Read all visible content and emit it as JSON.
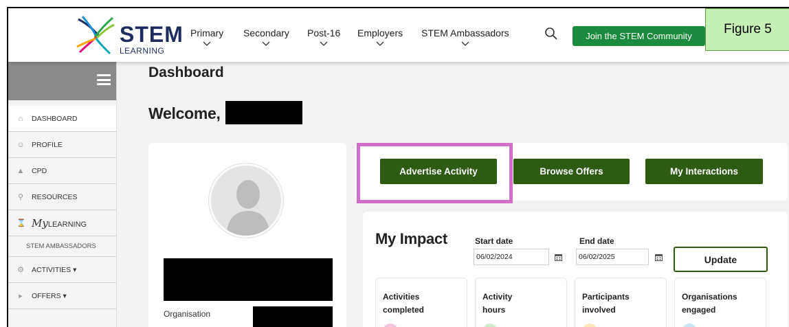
{
  "brand": {
    "name": "STEM",
    "sub": "LEARNING",
    "colors": {
      "navy": "#1d2b5e",
      "green": "#1c8a3c",
      "dark_green": "#2f5a12",
      "highlight": "#d46ecb"
    }
  },
  "nav": {
    "items": [
      {
        "label": "Primary"
      },
      {
        "label": "Secondary"
      },
      {
        "label": "Post-16"
      },
      {
        "label": "Employers"
      },
      {
        "label": "STEM Ambassadors"
      }
    ],
    "search_icon": "search-icon",
    "join_label": "Join the STEM Community"
  },
  "figure_label": "Figure 5",
  "sidebar": {
    "items": [
      {
        "label": "DASHBOARD",
        "icon": "home-icon"
      },
      {
        "label": "PROFILE",
        "icon": "user-icon"
      },
      {
        "label": "CPD",
        "icon": "graduation-cap-icon"
      },
      {
        "label": "RESOURCES",
        "icon": "search-icon"
      },
      {
        "label_prefix": "My",
        "label": "LEARNING",
        "icon": "hourglass-icon"
      },
      {
        "label": "STEM AMBASSADORS"
      },
      {
        "label": "ACTIVITIES ▾",
        "icon": "gear-icon"
      },
      {
        "label": "OFFERS ▾",
        "icon": "megaphone-icon"
      }
    ]
  },
  "main": {
    "title": "Dashboard",
    "welcome": "Welcome,",
    "organisation_label": "Organisation",
    "actions": {
      "advertise": "Advertise Activity",
      "browse": "Browse Offers",
      "interactions": "My Interactions"
    },
    "impact": {
      "title": "My Impact",
      "start_label": "Start date",
      "start_value": "06/02/2024",
      "end_label": "End date",
      "end_value": "06/02/2025",
      "update_label": "Update",
      "stats": [
        {
          "line1": "Activities",
          "line2": "completed",
          "color": "#f4c6dd"
        },
        {
          "line1": "Activity",
          "line2": "hours",
          "color": "#cfeccb"
        },
        {
          "line1": "Participants",
          "line2": "involved",
          "color": "#fbe7b8"
        },
        {
          "line1": "Organisations",
          "line2": "engaged",
          "color": "#c8e4f5"
        }
      ]
    }
  }
}
